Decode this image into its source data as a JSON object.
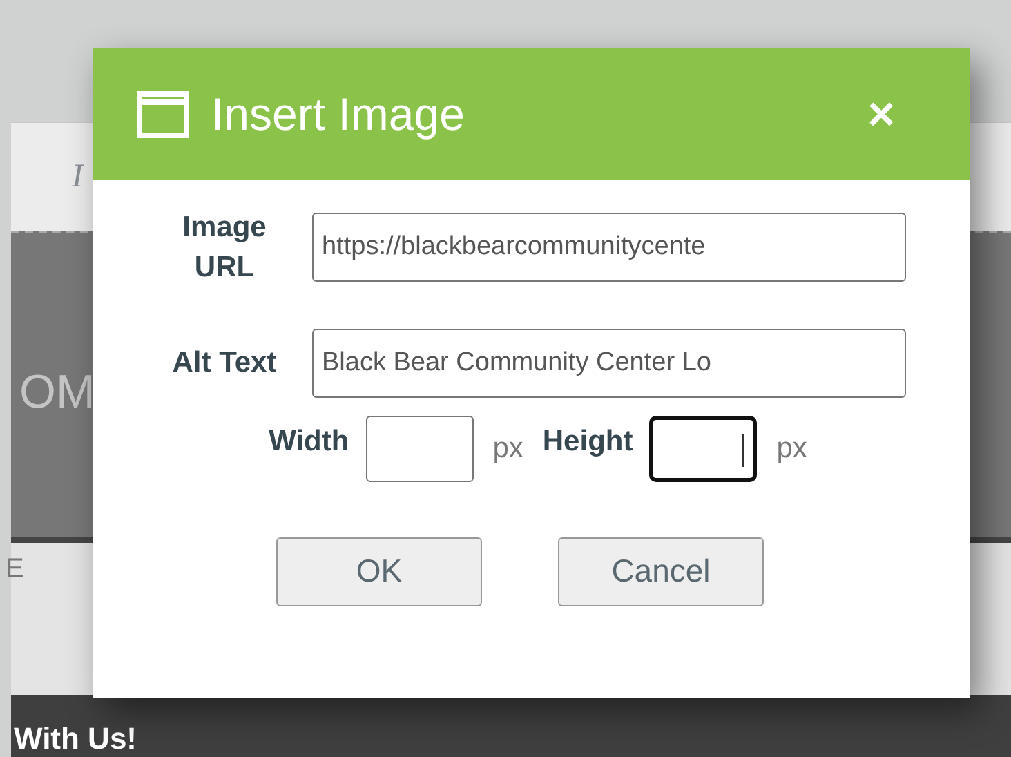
{
  "background": {
    "toolbar_glyph": "I",
    "banner_text": "OM",
    "strip_text": "E",
    "footer_text": "With Us!"
  },
  "dialog": {
    "title": "Insert Image",
    "close": "×",
    "fields": [
      {
        "label": "Image URL",
        "value": "https://blackbearcommunitycente"
      },
      {
        "label": "Alt Text",
        "value": "Black Bear Community Center Lo"
      }
    ],
    "size": [
      {
        "label": "Width",
        "unit": "px",
        "focused": false
      },
      {
        "label": "Height",
        "unit": "px",
        "focused": true
      }
    ],
    "buttons": [
      "OK",
      "Cancel"
    ]
  }
}
